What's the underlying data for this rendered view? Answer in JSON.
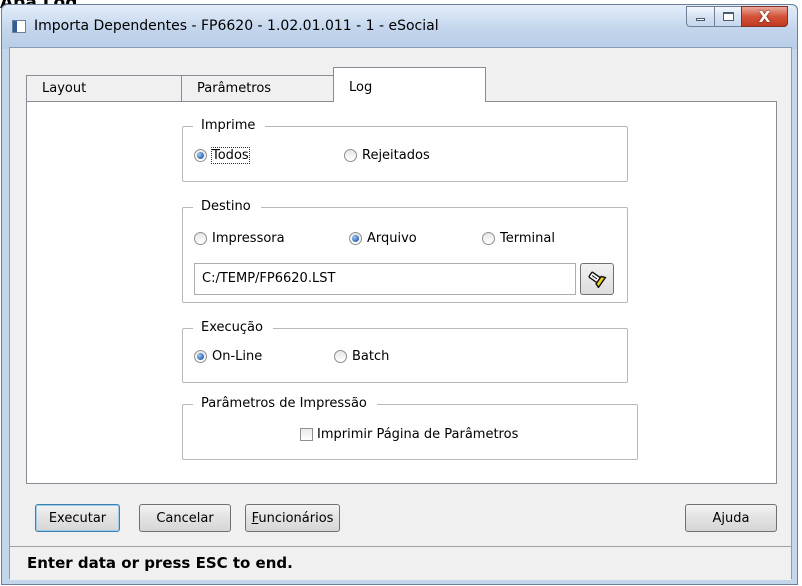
{
  "page_heading": "Aba Log",
  "window": {
    "title": "Importa Dependentes - FP6620 - 1.02.01.011 - 1 - eSocial",
    "icons": {
      "app": "app-window-icon",
      "minimize": "minimize-icon",
      "maximize": "maximize-icon",
      "close": "close-icon"
    },
    "close_glyph": "X"
  },
  "tabs": [
    {
      "label": "Layout",
      "active": false
    },
    {
      "label": "Parâmetros",
      "active": false
    },
    {
      "label": "Log",
      "active": true
    }
  ],
  "imprime": {
    "legend": "Imprime",
    "options": [
      {
        "label": "Todos",
        "selected": true
      },
      {
        "label": "Rejeitados",
        "selected": false
      }
    ]
  },
  "destino": {
    "legend": "Destino",
    "options": [
      {
        "label": "Impressora",
        "selected": false
      },
      {
        "label": "Arquivo",
        "selected": true
      },
      {
        "label": "Terminal",
        "selected": false
      }
    ],
    "file_path": "C:/TEMP/FP6620.LST",
    "browse_icon": "flashlight-icon"
  },
  "execucao": {
    "legend": "Execução",
    "options": [
      {
        "label": "On-Line",
        "selected": true
      },
      {
        "label": "Batch",
        "selected": false
      }
    ]
  },
  "parametros_impressao": {
    "legend": "Parâmetros de Impressão",
    "checkbox_label": "Imprimir Página de Parâmetros",
    "checked": false
  },
  "buttons": {
    "executar": "Executar",
    "cancelar": "Cancelar",
    "funcionarios_mnemonic": "F",
    "funcionarios_rest": "uncionários",
    "ajuda": "Ajuda"
  },
  "status": "Enter data or press ESC to end.",
  "colors": {
    "title_bar": "#c3d5ec",
    "close_button": "#c8452c",
    "radio_selected": "#2c66b4"
  }
}
